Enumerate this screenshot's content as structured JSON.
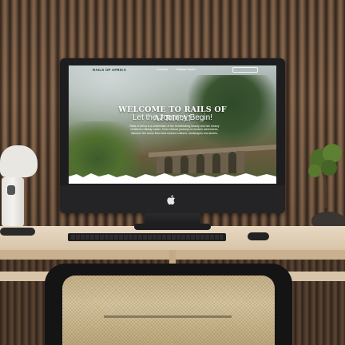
{
  "site": {
    "logo": "RAILS OF AFRICA",
    "nav": [
      "Journeys",
      "Railway Stories"
    ],
    "hero_title": "WELCOME TO RAILS OF AFRICA!",
    "hero_subtitle": "Let the Journey Begin!",
    "hero_body": "Rails of Africa is a celebration of the breathtaking beauty and rich history of Africa's railway routes. From historic journeys to modern adventures, discover the iconic lines that connect cultures, landscapes and stories."
  },
  "colors": {
    "logo": "#1f3b2a",
    "hero_text": "#ffffff",
    "monitor_bezel": "#1d1d1f",
    "wall_wood": "#7a5c44",
    "desk": "#e8d9c3"
  },
  "icons": [
    "apple-logo-icon"
  ]
}
